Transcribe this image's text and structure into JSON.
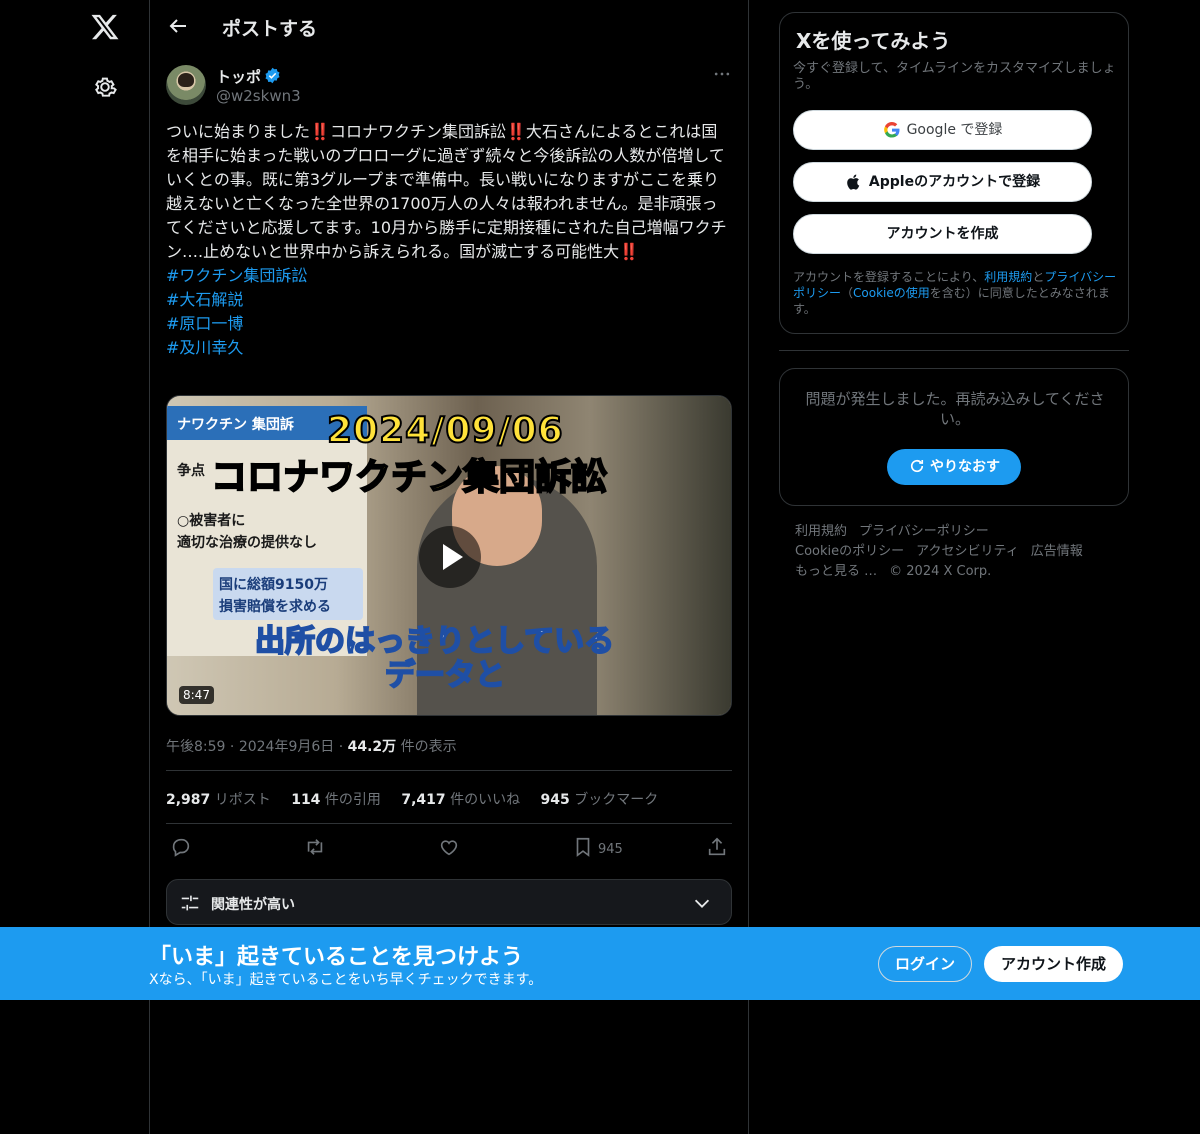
{
  "header": {
    "title": "ポストする"
  },
  "post": {
    "author_name": "トッポ",
    "author_handle": "@w2skwn3",
    "text_parts": [
      "ついに始まりました",
      "‼️",
      "コロナワクチン集団訴訟",
      "‼️",
      "大石さんによるとこれは国を相手に始まった戦いのプロローグに過ぎず続々と今後訴訟の人数が倍増していくとの事。既に第3グループまで準備中。長い戦いになりますがここを乗り越えないと亡くなった全世界の1700万人の人々は報われません。是非頑張ってくださいと応援してます。10月から勝手に定期接種にされた自己増幅ワクチン….止めないと世界中から訴えられる。国が滅亡する可能性大",
      "‼️"
    ],
    "hashtags": [
      "#ワクチン集団訴訟",
      "#大石解説",
      "#原口一博",
      "#及川幸久"
    ],
    "video": {
      "title_line1": "2024/09/06",
      "title_line2": "コロナワクチン集団訴訟",
      "board_header": "ナワクチン 集団訴",
      "board_line1": "争点",
      "board_line2": "○被害者に",
      "board_line3": "適切な治療の提供なし",
      "amount_line1": "国に総額9150万",
      "amount_line2": "損害賠償を求める",
      "caption_line1": "出所のはっきりとしている",
      "caption_line2": "データと",
      "duration": "8:47"
    },
    "time": "午後8:59",
    "date": "2024年9月6日",
    "views_value": "44.2万",
    "views_label": "件の表示",
    "stats": {
      "reposts_value": "2,987",
      "reposts_label": "リポスト",
      "quotes_value": "114",
      "quotes_label": "件の引用",
      "likes_value": "7,417",
      "likes_label": "件のいいね",
      "bookmarks_value": "945",
      "bookmarks_label": "ブックマーク"
    },
    "bookmark_count": "945",
    "relevance_label": "関連性が高い"
  },
  "sidebar": {
    "signup_title": "Xを使ってみよう",
    "signup_sub": "今すぐ登録して、タイムラインをカスタマイズしましょう。",
    "google_label": "Google で登録",
    "apple_label": "Appleのアカウントで登録",
    "create_label": "アカウントを作成",
    "legal_1": "アカウントを登録することにより、",
    "legal_terms": "利用規約",
    "legal_and": "と",
    "legal_privacy": "プライバシーポリシー",
    "legal_open": "（",
    "legal_cookie": "Cookieの使用",
    "legal_2": "を含む）に同意したとみなされます。",
    "error_text": "問題が発生しました。再読み込みしてください。",
    "retry_label": "やりなおす",
    "footer_links": [
      "利用規約",
      "プライバシーポリシー",
      "Cookieのポリシー",
      "アクセシビリティ",
      "広告情報",
      "もっと見る …",
      "© 2024 X Corp."
    ]
  },
  "banner": {
    "title": "「いま」起きていることを見つけよう",
    "sub": "Xなら、「いま」起きていることをいち早くチェックできます。",
    "login_label": "ログイン",
    "signup_label": "アカウント作成"
  },
  "colors": {
    "accent": "#1d9bf0",
    "background": "#000000",
    "muted": "#71767b",
    "text": "#e7e9ea"
  },
  "icons": [
    "x-logo-icon",
    "gear-icon",
    "back-arrow-icon",
    "verified-badge-icon",
    "more-icon",
    "play-icon",
    "reply-icon",
    "repost-icon",
    "like-icon",
    "bookmark-icon",
    "share-icon",
    "sliders-icon",
    "chevron-down-icon",
    "google-icon",
    "apple-icon",
    "refresh-icon"
  ]
}
